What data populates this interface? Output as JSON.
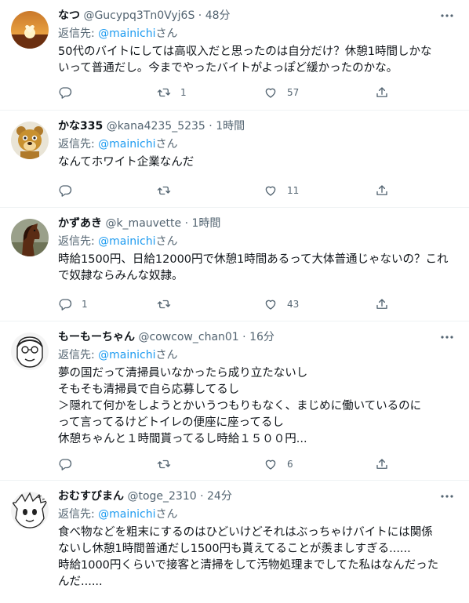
{
  "reply_prefix": "返信先: ",
  "reply_suffix": "さん",
  "tweets": [
    {
      "name": "なつ",
      "handle": "@Gucypq3Tn0Vyj6S",
      "sep": "·",
      "time": "48分",
      "reply_to": "@mainichi",
      "lines": [
        "50代のバイトにしては高収入だと思ったのは自分だけ？休憩1時間しかな",
        "いって普通だし。今までやったバイトがよっぽど緩かったのかな。"
      ],
      "replies": "",
      "retweets": "1",
      "likes": "57",
      "avatar_icon": "sunset-avatar"
    },
    {
      "name": "かな335",
      "handle": "@kana4235_5235",
      "sep": "·",
      "time": "1時間",
      "reply_to": "@mainichi",
      "lines": [
        "なんてホワイト企業なんだ"
      ],
      "replies": "",
      "retweets": "",
      "likes": "11",
      "avatar_icon": "bear-avatar"
    },
    {
      "name": "かずあき",
      "handle": "@k_mauvette",
      "sep": "·",
      "time": "1時間",
      "reply_to": "@mainichi",
      "lines": [
        "時給1500円、日給12000円で休憩1時間あるって大体普通じゃないの？これ",
        "で奴隷ならみんな奴隷。"
      ],
      "replies": "1",
      "retweets": "",
      "likes": "43",
      "avatar_icon": "horse-avatar"
    },
    {
      "name": "もーもーちゃん",
      "handle": "@cowcow_chan01",
      "sep": "·",
      "time": "16分",
      "reply_to": "@mainichi",
      "lines": [
        "夢の国だって清掃員いなかったら成り立たないし",
        "そもそも清掃員で自ら応募してるし",
        "＞隠れて何かをしようとかいうつもりもなく、まじめに働いているのに",
        "って言ってるけどトイレの便座に座ってるし",
        "休憩ちゃんと１時間貰ってるし時給１５００円..."
      ],
      "replies": "",
      "retweets": "",
      "likes": "6",
      "avatar_icon": "cartoon-face-avatar"
    },
    {
      "name": "おむすびまん",
      "handle": "@toge_2310",
      "sep": "·",
      "time": "24分",
      "reply_to": "@mainichi",
      "lines": [
        "食べ物などを粗末にするのはひどいけどそれはぶっちゃけバイトには関係",
        "ないし休憩1時間普通だし1500円も貰えてることが羨ましすぎる......",
        "時給1000円くらいで接客と清掃をして汚物処理までしてた私はなんだった",
        "んだ......"
      ],
      "replies": "",
      "retweets": "",
      "likes": "",
      "avatar_icon": "manga-avatar"
    }
  ]
}
